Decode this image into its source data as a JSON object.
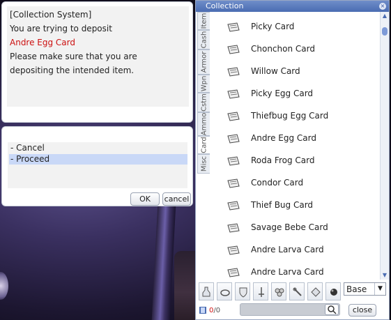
{
  "dialog": {
    "lines": [
      "[Collection System]",
      "You are trying to deposit",
      "Andre Egg Card",
      "Please make sure that you are",
      "depositing the intended item."
    ],
    "highlight_color": "#cc1010"
  },
  "menu": {
    "items": [
      "- Cancel",
      "- Proceed"
    ],
    "selected": "- Proceed",
    "ok_label": "OK",
    "cancel_label": "cancel"
  },
  "collection": {
    "title": "Collection",
    "tabs": [
      "Item",
      "Cash",
      "Armor",
      "Wpn",
      "Cstm",
      "Ammo",
      "Card",
      "Misc"
    ],
    "active_tab": "Card",
    "items": [
      "Picky Card",
      "Chonchon Card",
      "Willow Card",
      "Picky Egg Card",
      "Thiefbug Egg Card",
      "Andre Egg Card",
      "Roda Frog Card",
      "Condor Card",
      "Thief Bug Card",
      "Savage Bebe Card",
      "Andre Larva Card",
      "Andre Larva Card"
    ],
    "filter_icons": [
      "potion-icon",
      "ring-icon",
      "shield-icon",
      "sword-icon",
      "flower-icon",
      "wrench-icon",
      "diamond-icon",
      "ball-icon"
    ],
    "grade_select": "Base",
    "count": {
      "current": "0",
      "total": "0"
    },
    "search_placeholder": "",
    "close_label": "close"
  },
  "colors": {
    "title_bar": "#4a6cb2",
    "selected_row": "#c9d8f7"
  }
}
